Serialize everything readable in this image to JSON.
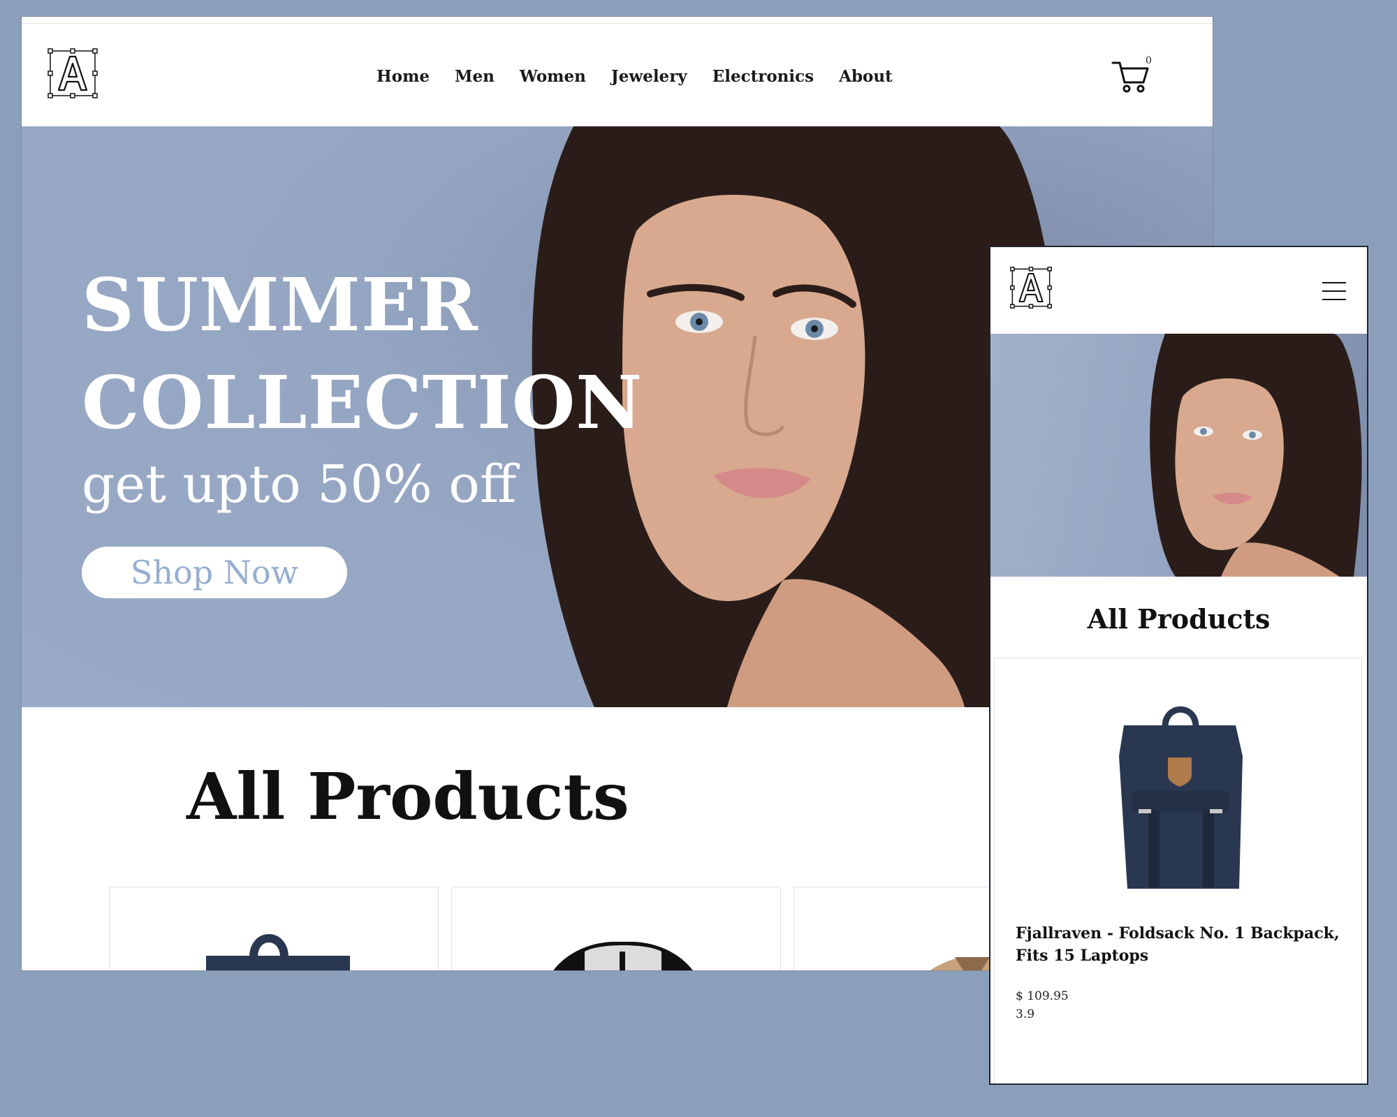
{
  "brand": {
    "logo_letter": "A"
  },
  "desktop": {
    "nav": {
      "items": [
        {
          "label": "Home"
        },
        {
          "label": "Men"
        },
        {
          "label": "Women"
        },
        {
          "label": "Jewelery"
        },
        {
          "label": "Electronics"
        },
        {
          "label": "About"
        }
      ],
      "cart_count": "0"
    },
    "hero": {
      "title": "SUMMER\nCOLLECTION",
      "subtitle": "get upto 50% off",
      "button_label": "Shop Now"
    },
    "section_heading": "All Products"
  },
  "mobile": {
    "section_heading": "All Products",
    "product": {
      "title": "Fjallraven - Foldsack No. 1 Backpack, Fits 15 Laptops",
      "price": "$ 109.95",
      "rating": "3.9"
    }
  },
  "colors": {
    "page_background": "#8c9fba",
    "hero_background": "#95a6c2",
    "button_text": "#96aed1",
    "backpack": "#2a3750"
  },
  "icons": [
    "logo-icon",
    "cart-icon",
    "hamburger-menu-icon"
  ]
}
